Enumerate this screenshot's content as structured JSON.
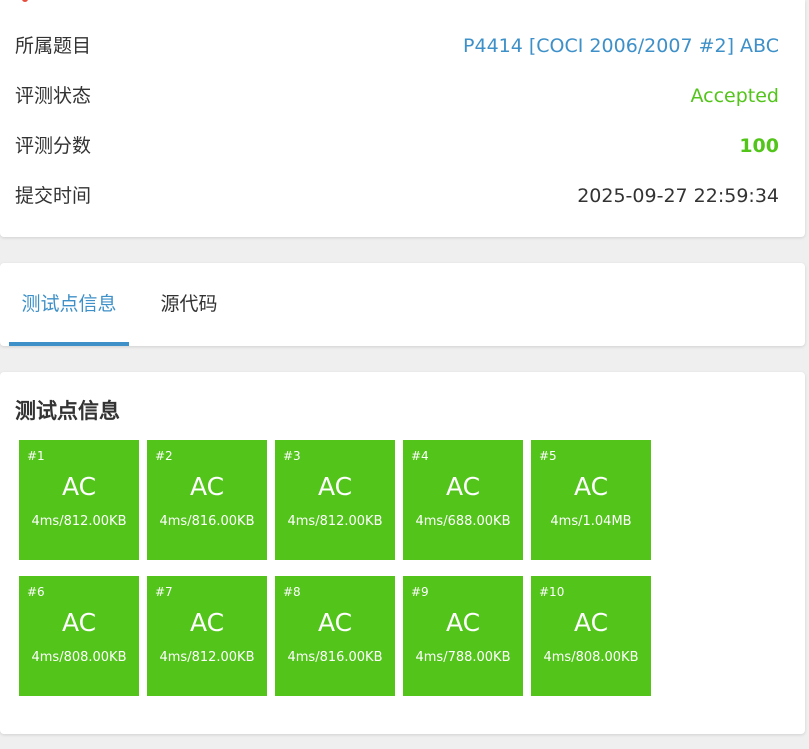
{
  "info": {
    "rows": [
      {
        "label": "所属题目",
        "value": "P4414 [COCI 2006/2007 #2] ABC"
      },
      {
        "label": "评测状态",
        "value": "Accepted"
      },
      {
        "label": "评测分数",
        "value": "100"
      },
      {
        "label": "提交时间",
        "value": "2025-09-27 22:59:34"
      }
    ]
  },
  "tabs": [
    {
      "label": "测试点信息",
      "active": true
    },
    {
      "label": "源代码",
      "active": false
    }
  ],
  "testcases": {
    "title": "测试点信息",
    "items": [
      {
        "id": "#1",
        "result": "AC",
        "stat": "4ms/812.00KB"
      },
      {
        "id": "#2",
        "result": "AC",
        "stat": "4ms/816.00KB"
      },
      {
        "id": "#3",
        "result": "AC",
        "stat": "4ms/812.00KB"
      },
      {
        "id": "#4",
        "result": "AC",
        "stat": "4ms/688.00KB"
      },
      {
        "id": "#5",
        "result": "AC",
        "stat": "4ms/1.04MB"
      },
      {
        "id": "#6",
        "result": "AC",
        "stat": "4ms/808.00KB"
      },
      {
        "id": "#7",
        "result": "AC",
        "stat": "4ms/812.00KB"
      },
      {
        "id": "#8",
        "result": "AC",
        "stat": "4ms/816.00KB"
      },
      {
        "id": "#9",
        "result": "AC",
        "stat": "4ms/788.00KB"
      },
      {
        "id": "#10",
        "result": "AC",
        "stat": "4ms/808.00KB"
      }
    ]
  },
  "colors": {
    "accent": "#3e90c8",
    "accepted": "#52c41a",
    "background": "#efefef"
  }
}
